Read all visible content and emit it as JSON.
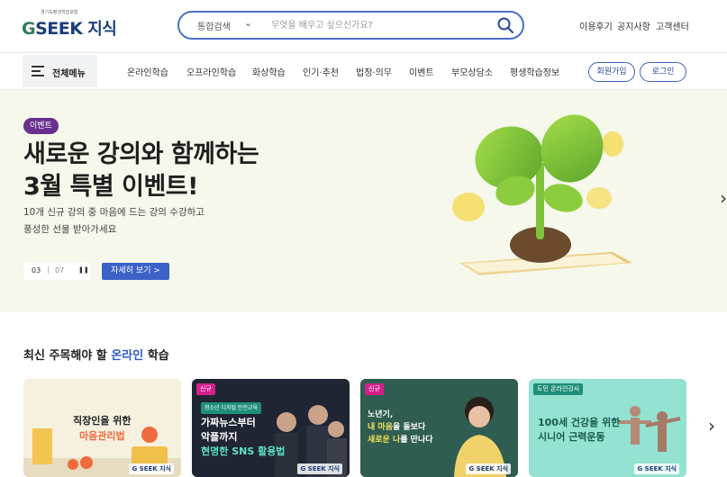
{
  "header": {
    "logo_sub": "경기도평생학습포털",
    "logo_g": "G",
    "logo_seek": "SEEK",
    "logo_k": " 지식",
    "search": {
      "scope": "통합검색",
      "placeholder": "무엇을 배우고 싶으신가요?"
    },
    "util_links": [
      "이용후기",
      "공지사항",
      "고객센터"
    ]
  },
  "nav": {
    "all_menu": "전체메뉴",
    "items": [
      "온라인학습",
      "오프라인학습",
      "화상학습",
      "인기·추천",
      "법정·의무",
      "이벤트",
      "부모상담소",
      "평생학습정보"
    ],
    "signup": "회원가입",
    "login": "로그인"
  },
  "hero": {
    "badge": "이벤트",
    "title_line1": "새로운 강의와 함께하는",
    "title_line2": "3월 특별 이벤트!",
    "desc_line1": "10개 신규 강의 중 마음에 드는 강의 수강하고",
    "desc_line2": "풍성한 선물 받아가세요",
    "pager_current": "03",
    "pager_sep": "|",
    "pager_total": "07",
    "detail_button": "자세히 보기  >"
  },
  "section": {
    "title_pre": "최신 주목해야 할 ",
    "title_hl": "온라인",
    "title_post": " 학습"
  },
  "cards": [
    {
      "tag": "",
      "line1": "직장인을 위한",
      "line2": "마음관리법",
      "logo": "G SEEK 지식"
    },
    {
      "tag": "신규",
      "subtag": "청소년 디지털 안전교육",
      "line1": "가짜뉴스부터",
      "line2": "악플까지",
      "line3": "현명한 SNS 활용법",
      "logo": "G SEEK 지식"
    },
    {
      "tag": "신규",
      "line1": "노년기,",
      "line2a": "내 마음",
      "line2b": "을 돌보다",
      "line3a": "새로운 나",
      "line3b": "를 만나다",
      "logo": "G SEEK 지식"
    },
    {
      "tag": "도민 온라인강사",
      "line1": "100세 건강을 위한",
      "line2": "시니어 근력운동",
      "logo": "G SEEK 지식"
    }
  ],
  "colors": {
    "brand_blue": "#1a3d7c",
    "accent_blue": "#3c62c8",
    "event_purple": "#6b2f8f",
    "hero_bg": "#f5f8ea",
    "tag_pink": "#d61f8c",
    "tag_teal": "#1f8f7a"
  }
}
